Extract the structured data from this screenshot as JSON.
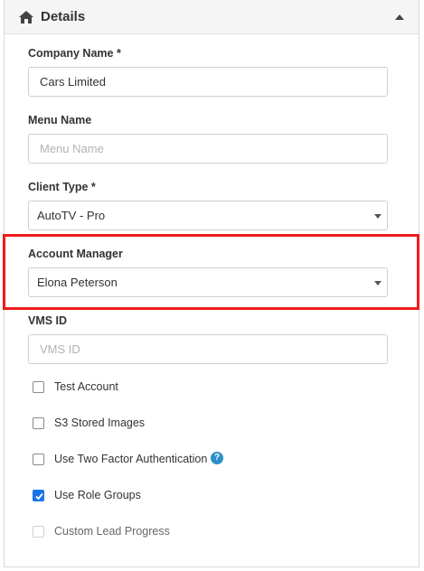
{
  "panel": {
    "title": "Details"
  },
  "fields": {
    "company_name": {
      "label": "Company Name *",
      "value": "Cars Limited"
    },
    "menu_name": {
      "label": "Menu Name",
      "value": "",
      "placeholder": "Menu Name"
    },
    "client_type": {
      "label": "Client Type *",
      "value": "AutoTV - Pro"
    },
    "account_manager": {
      "label": "Account Manager",
      "value": "Elona Peterson"
    },
    "vms_id": {
      "label": "VMS ID",
      "value": "",
      "placeholder": "VMS ID"
    }
  },
  "checkboxes": [
    {
      "label": "Test Account",
      "checked": false,
      "disabled": false
    },
    {
      "label": "S3 Stored Images",
      "checked": false,
      "disabled": false
    },
    {
      "label": "Use Two Factor Authentication",
      "checked": false,
      "disabled": false,
      "help": "?"
    },
    {
      "label": "Use Role Groups",
      "checked": true,
      "disabled": false
    },
    {
      "label": "Custom Lead Progress",
      "checked": false,
      "disabled": true
    }
  ],
  "colors": {
    "highlight": "#ec1c1c",
    "checkbox_checked": "#1a73e8",
    "help_icon": "#2b8ec7"
  },
  "icons": {
    "header": "home-icon",
    "collapse": "caret-up-icon",
    "help": "question-circle-icon"
  }
}
